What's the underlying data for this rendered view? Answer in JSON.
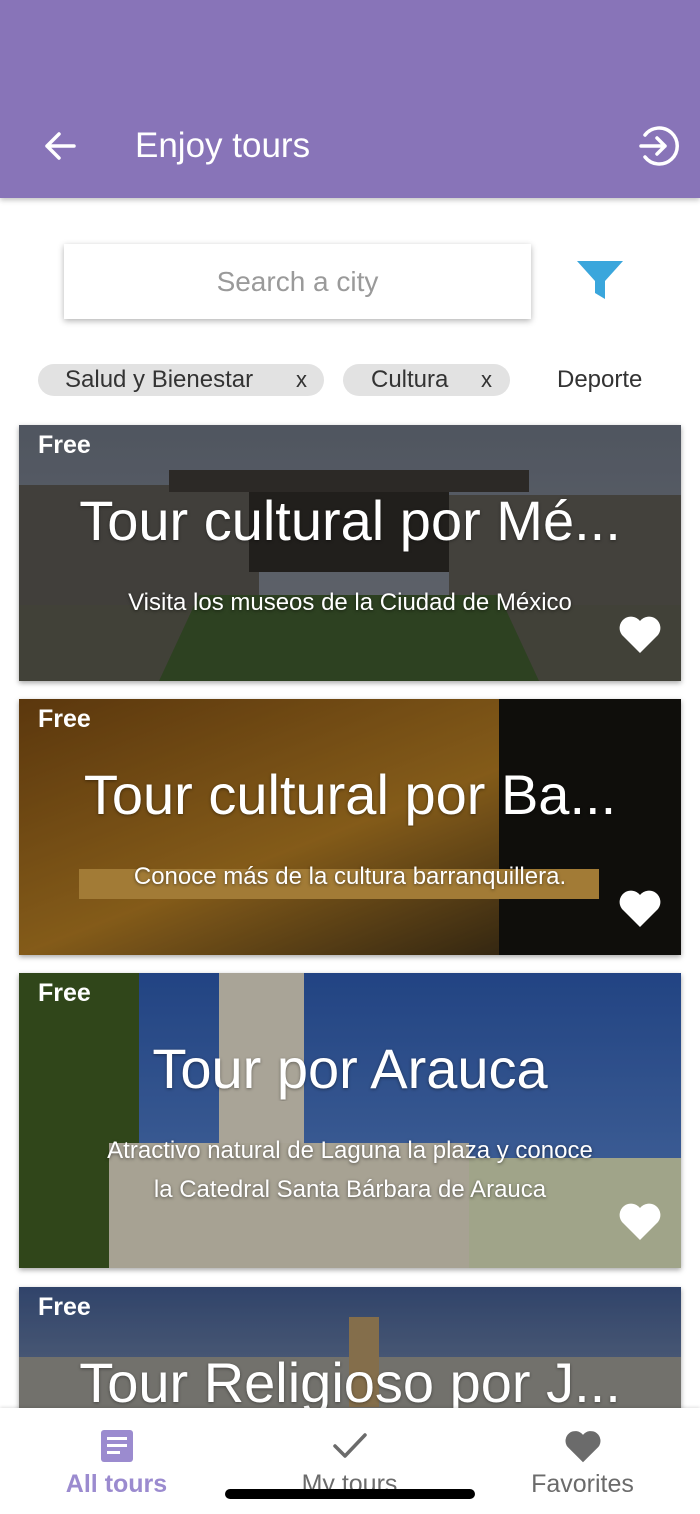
{
  "app": {
    "title": "Enjoy tours",
    "header_color": "#8874b8",
    "icons": {
      "back": "arrow-left-icon",
      "login": "login-circle-icon",
      "filter": "filter-funnel-icon"
    }
  },
  "search": {
    "placeholder": "Search a city",
    "value": ""
  },
  "filter": {
    "color": "#3aa6dc"
  },
  "chips": [
    {
      "label": "Salud y Bienestar",
      "remove": "x",
      "selected": true
    },
    {
      "label": "Cultura",
      "remove": "x",
      "selected": true
    },
    {
      "label": "Deporte",
      "selected": false
    }
  ],
  "tours": [
    {
      "badge": "Free",
      "title": "Tour cultural por Mé...",
      "description": "Visita los museos de la Ciudad de México",
      "favorite_icon": "heart-icon"
    },
    {
      "badge": "Free",
      "title": "Tour cultural por Ba...",
      "description": "Conoce más de la cultura barranquillera.",
      "favorite_icon": "heart-icon"
    },
    {
      "badge": "Free",
      "title": "Tour por Arauca",
      "description_lines": [
        "Atractivo natural de Laguna la plaza y conoce",
        "la Catedral Santa Bárbara de Arauca"
      ],
      "favorite_icon": "heart-icon"
    },
    {
      "badge": "Free",
      "title": "Tour Religioso por J..."
    }
  ],
  "bottom_nav": [
    {
      "label": "All tours",
      "icon": "document-list-icon",
      "active": true,
      "active_color": "#9b8bcf"
    },
    {
      "label": "My tours",
      "icon": "checkmark-icon",
      "active": false
    },
    {
      "label": "Favorites",
      "icon": "heart-icon",
      "active": false
    }
  ]
}
